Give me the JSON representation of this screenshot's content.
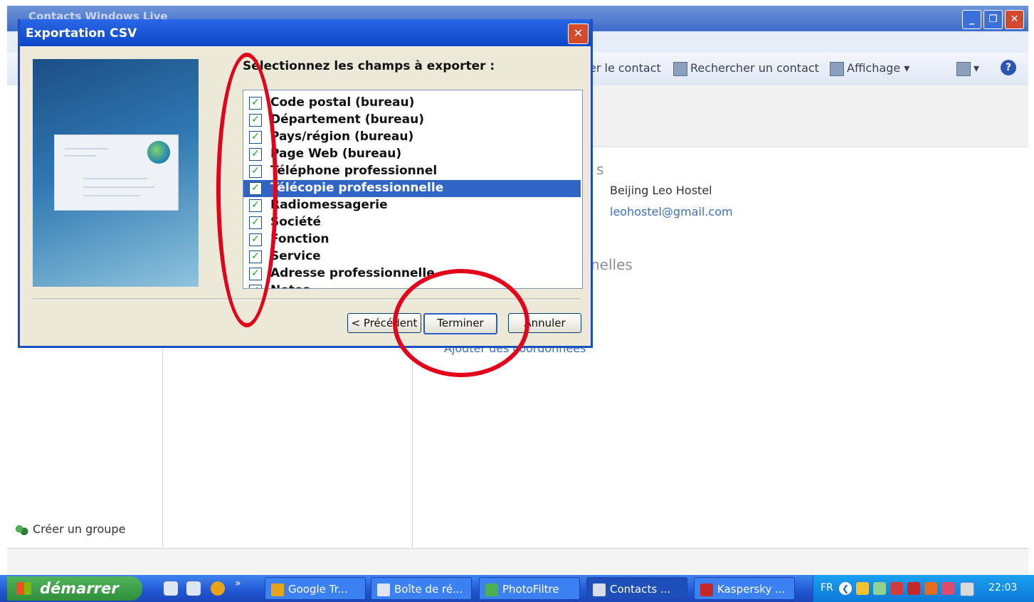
{
  "main_window": {
    "title": "Contacts Windows Live",
    "controls": {
      "minimize": "_",
      "maximize": "❐",
      "close": "✕"
    },
    "toolbar": {
      "delete_contact": "er le contact",
      "find_contact": "Rechercher un contact",
      "view": "Affichage",
      "view_chevron": "▾",
      "extra_chevron": "▾",
      "help": "?"
    },
    "create_group": "Créer un groupe",
    "contact": {
      "section_fragment": "s",
      "company": "Beijing Leo Hostel",
      "email": "leohostel@gmail.com",
      "personal_fragment": "nelles",
      "add_details_link": "Ajouter des coordonnées"
    }
  },
  "dialog": {
    "title": "Exportation CSV",
    "close": "✕",
    "prompt": "Sélectionnez les champs à exporter :",
    "fields": [
      {
        "label": "Code postal (bureau)",
        "checked": true,
        "selected": false
      },
      {
        "label": "Département (bureau)",
        "checked": true,
        "selected": false
      },
      {
        "label": "Pays/région (bureau)",
        "checked": true,
        "selected": false
      },
      {
        "label": "Page Web (bureau)",
        "checked": true,
        "selected": false
      },
      {
        "label": "Téléphone professionnel",
        "checked": true,
        "selected": false
      },
      {
        "label": "Télécopie professionnelle",
        "checked": true,
        "selected": true
      },
      {
        "label": "Radiomessagerie",
        "checked": true,
        "selected": false
      },
      {
        "label": "Société",
        "checked": true,
        "selected": false
      },
      {
        "label": "Fonction",
        "checked": true,
        "selected": false
      },
      {
        "label": "Service",
        "checked": true,
        "selected": false
      },
      {
        "label": "Adresse professionnelle",
        "checked": true,
        "selected": false
      },
      {
        "label": "Notes",
        "checked": true,
        "selected": false
      }
    ],
    "check_mark": "✓",
    "buttons": {
      "previous": "< Précédent",
      "finish": "Terminer",
      "cancel": "Annuler"
    }
  },
  "taskbar": {
    "start": "démarrer",
    "overflow": "»",
    "tasks": [
      {
        "label": "Google Tr...",
        "icon_color": "#e8a317",
        "active": false
      },
      {
        "label": "Boîte de ré...",
        "icon_color": "#dfe6f2",
        "active": false
      },
      {
        "label": "PhotoFiltre",
        "icon_color": "#4caf50",
        "active": false
      },
      {
        "label": "Contacts ...",
        "icon_color": "#d8dee9",
        "active": true
      },
      {
        "label": "Kaspersky ...",
        "icon_color": "#c62828",
        "active": false
      }
    ],
    "tray": {
      "language": "FR",
      "clock": "22:03",
      "collapse": "❮"
    }
  },
  "colors": {
    "annotation_red": "#e3001b",
    "selection_blue": "#3165c5",
    "link_blue": "#3c6fc4",
    "xp_title_blue": "#0a48c9"
  }
}
